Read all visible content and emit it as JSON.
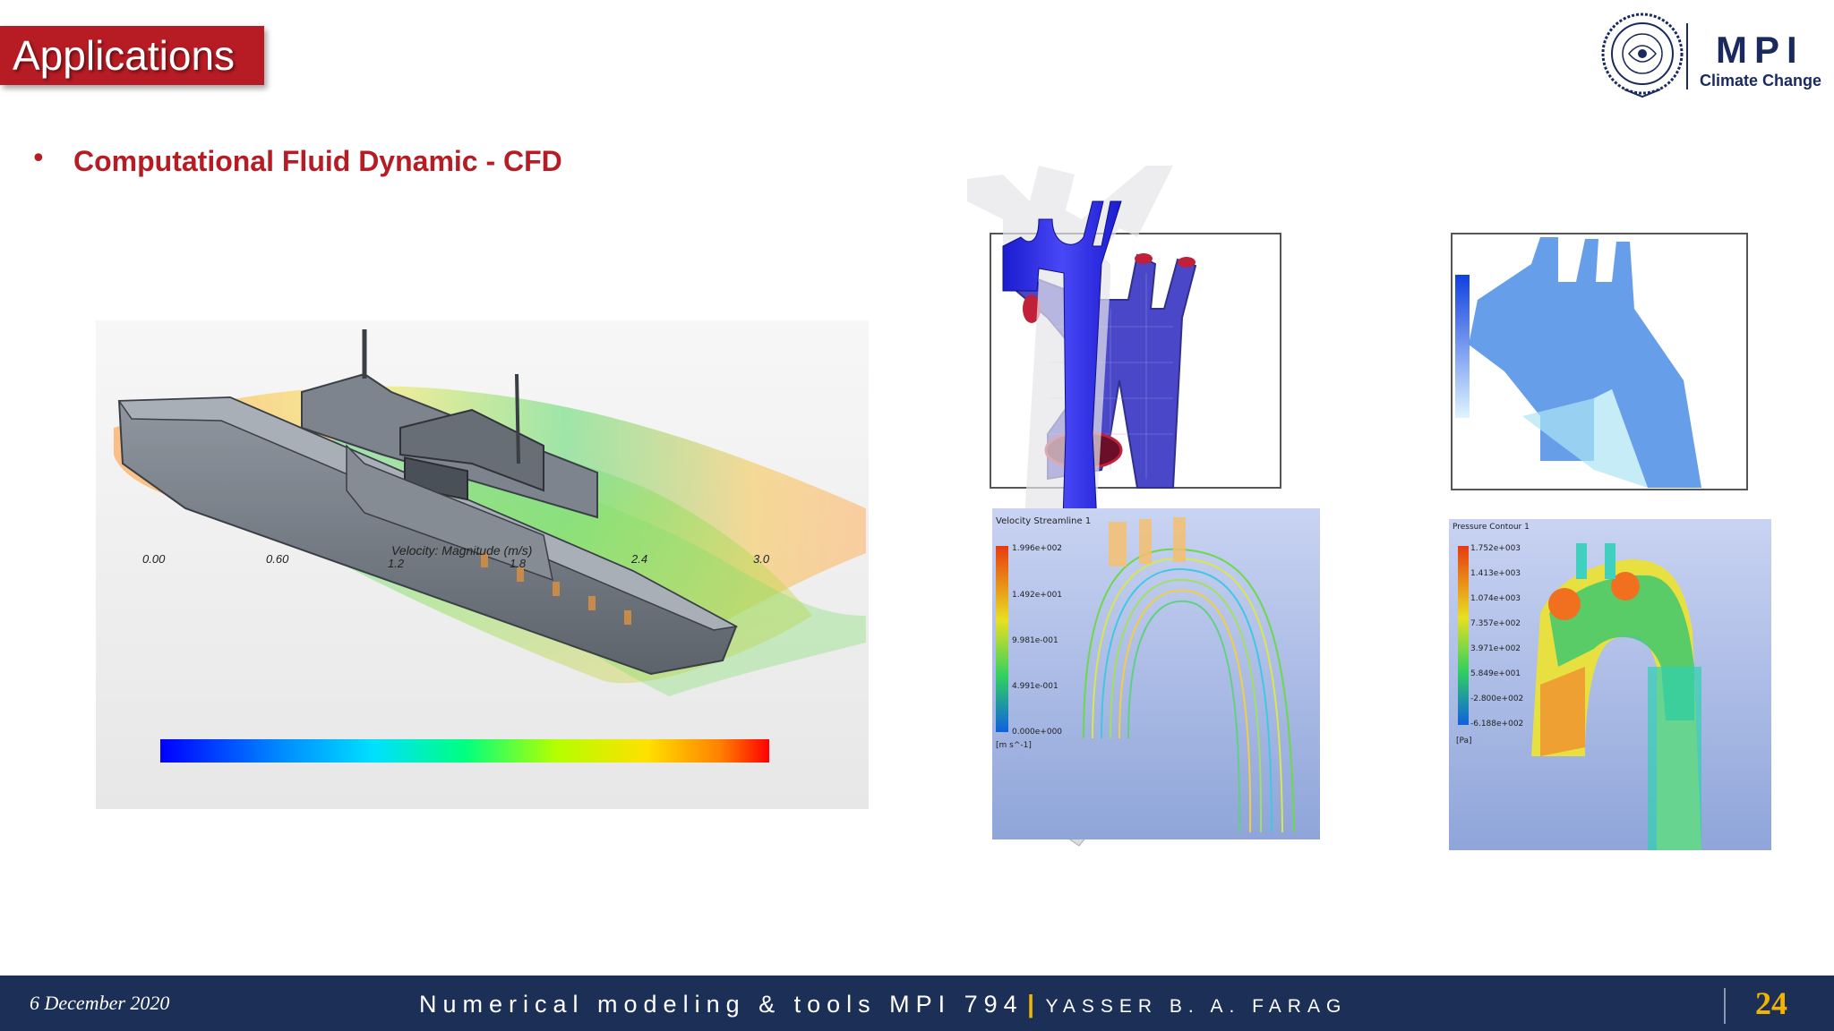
{
  "header": {
    "title": "Applications",
    "logo": {
      "text": "MPI",
      "subtitle": "Climate Change",
      "icon": "emblem-seal-icon"
    }
  },
  "content": {
    "bullet": "Computational Fluid Dynamic - CFD",
    "ship_figure": {
      "legend_title": "Velocity: Magnitude (m/s)",
      "tick_labels": [
        "0.00",
        "0.60",
        "1.2",
        "1.8",
        "2.4",
        "3.0"
      ]
    },
    "vessel_figure": {
      "velocity_panel": {
        "legend_title": "Velocity\nStreamline 1",
        "ticks": [
          "1.996e+002",
          "1.492e+001",
          "9.981e-001",
          "4.991e-001",
          "0.000e+000"
        ],
        "unit": "[m s^-1]"
      },
      "pressure_panel": {
        "legend_title": "Pressure\nContour 1",
        "ticks": [
          "1.752e+003",
          "1.413e+003",
          "1.074e+003",
          "7.357e+002",
          "3.971e+002",
          "5.849e+001",
          "-2.800e+002",
          "-6.188e+002"
        ],
        "unit": "[Pa]"
      }
    }
  },
  "footer": {
    "date": "6 December 2020",
    "course": "Numerical modeling & tools  MPI 794",
    "separator": "|",
    "author": "YASSER B. A. FARAG",
    "page": "24"
  },
  "colors": {
    "accent_red": "#b71c24",
    "footer_navy": "#1c2f57",
    "page_gold": "#f2b400",
    "logo_navy": "#1a2a5e"
  }
}
